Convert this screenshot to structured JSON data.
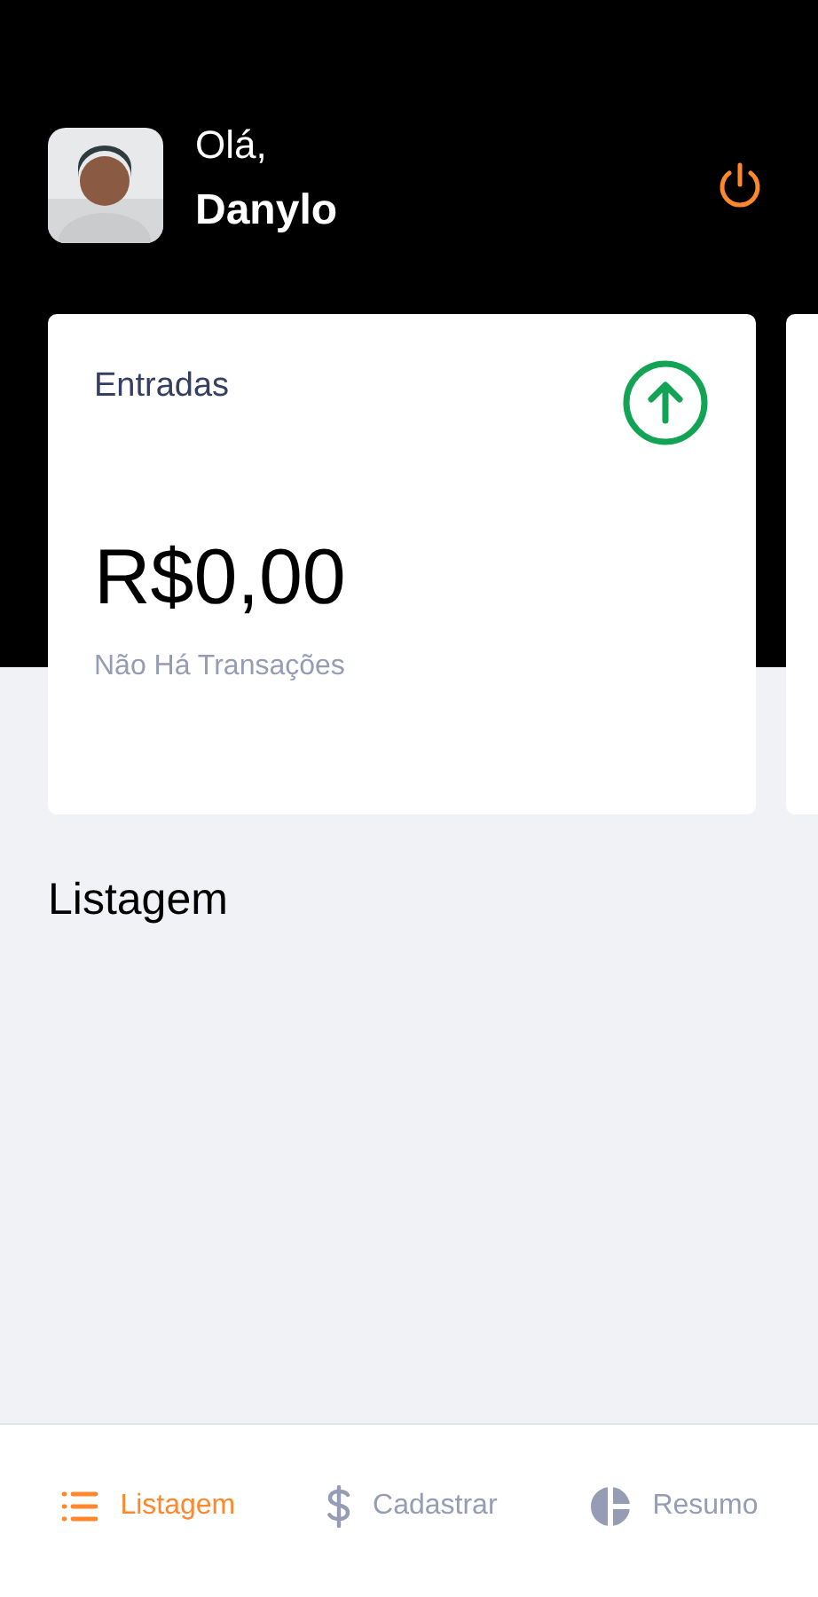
{
  "header": {
    "greeting": "Olá,",
    "user_name": "Danylo"
  },
  "cards": [
    {
      "kind": "income",
      "title": "Entradas",
      "amount": "R$0,00",
      "subtitle": "Não Há Transações"
    }
  ],
  "section_title": "Listagem",
  "tabs": [
    {
      "kind": "list",
      "label": "Listagem",
      "selected": true
    },
    {
      "kind": "dollar",
      "label": "Cadastrar",
      "selected": false
    },
    {
      "kind": "pie",
      "label": "Resumo",
      "selected": false
    }
  ]
}
